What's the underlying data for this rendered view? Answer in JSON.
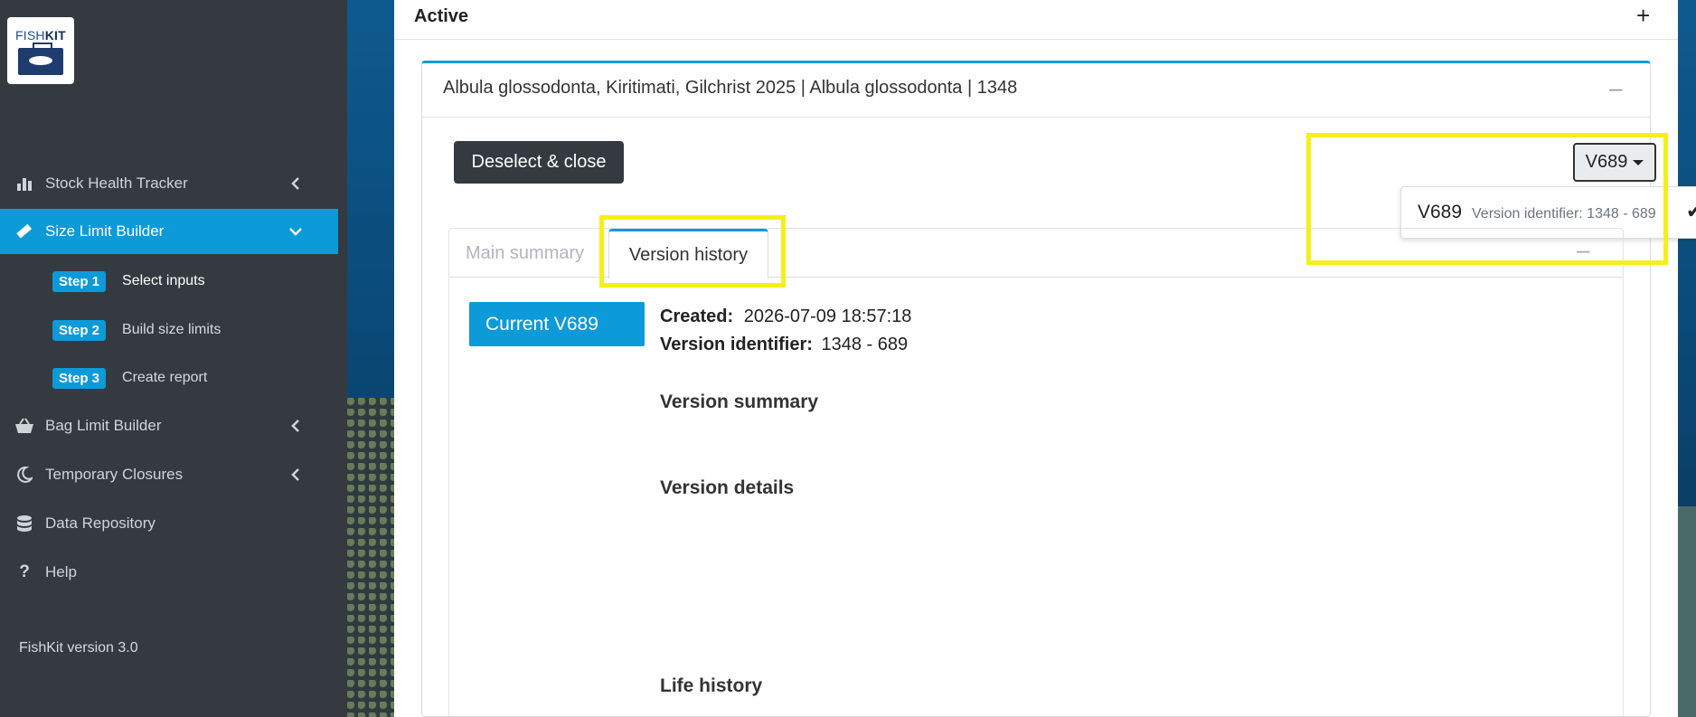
{
  "sidebar": {
    "logo": {
      "text_plain": "FISH",
      "text_bold": "KIT"
    },
    "nav": [
      {
        "label": "Stock Health Tracker",
        "icon": "bar-chart-icon",
        "chevron": "chevron-left"
      },
      {
        "label": "Size Limit Builder",
        "icon": "ruler-icon",
        "chevron": "chevron-down",
        "active": true
      },
      {
        "label": "Bag Limit Builder",
        "icon": "basket-icon",
        "chevron": "chevron-left"
      },
      {
        "label": "Temporary Closures",
        "icon": "moon-icon",
        "chevron": "chevron-left"
      },
      {
        "label": "Data Repository",
        "icon": "database-icon"
      },
      {
        "label": "Help",
        "icon": "question-icon"
      }
    ],
    "steps": [
      {
        "badge": "Step 1",
        "label": "Select inputs"
      },
      {
        "badge": "Step 2",
        "label": "Build size limits"
      },
      {
        "badge": "Step 3",
        "label": "Create report"
      }
    ],
    "version": "FishKit version 3.0"
  },
  "main": {
    "active_title": "Active",
    "plus": "+",
    "card_title": "Albula glossodonta, Kiritimati, Gilchrist 2025 | Albula glossodonta | 1348",
    "minus": "–",
    "deselect_label": "Deselect & close",
    "version_dropdown": {
      "selected": "V689",
      "menu_item_main": "V689",
      "menu_item_sub": "Version identifier: 1348 - 689",
      "check": "✔"
    },
    "tabs": [
      "Main summary",
      "Version history"
    ],
    "current_button": "Current V689",
    "created_label": "Created:",
    "created_value": "2026-07-09 18:57:18",
    "identifier_label": "Version identifier:",
    "identifier_value": "1348 - 689",
    "sections": [
      "Version summary",
      "Version details",
      "Life history"
    ]
  },
  "colors": {
    "accent": "#0d9ad8",
    "sidebar": "#343a40",
    "highlight": "#f5ef1a"
  }
}
